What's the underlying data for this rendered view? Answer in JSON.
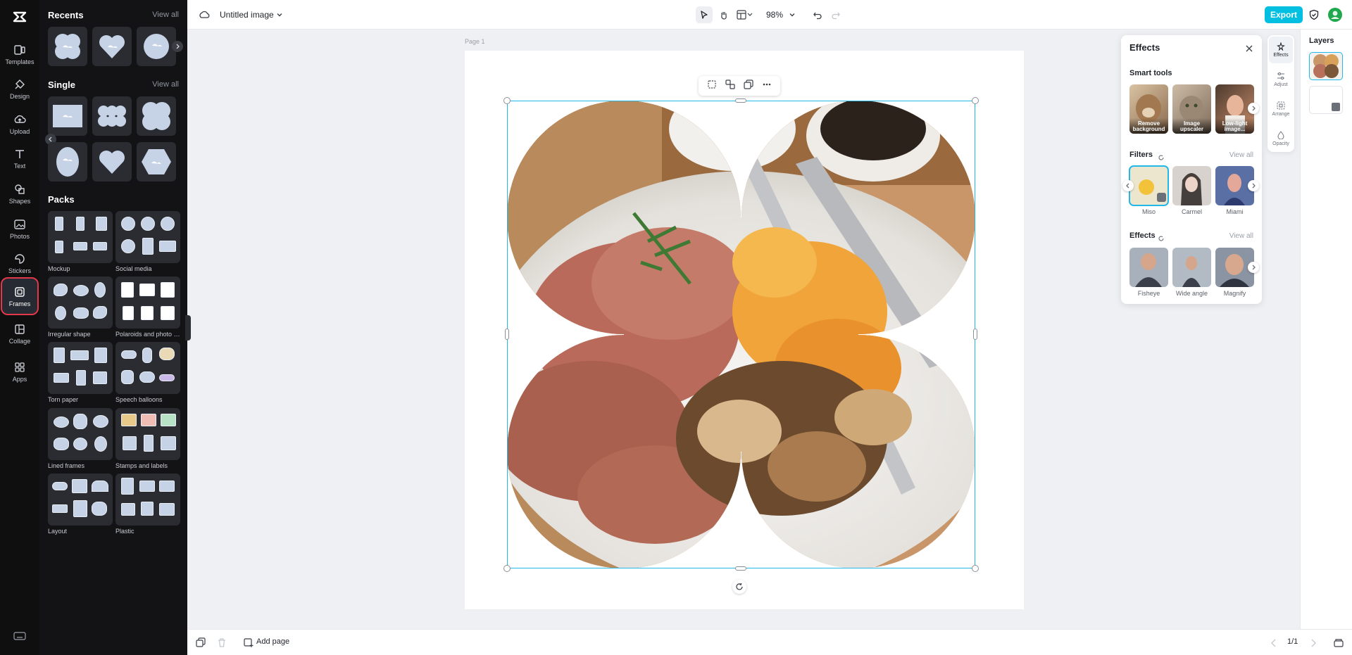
{
  "rail": {
    "items": [
      {
        "label": "Templates",
        "icon": "templates-icon"
      },
      {
        "label": "Design",
        "icon": "design-icon"
      },
      {
        "label": "Upload",
        "icon": "upload-icon"
      },
      {
        "label": "Text",
        "icon": "text-icon"
      },
      {
        "label": "Shapes",
        "icon": "shapes-icon"
      },
      {
        "label": "Photos",
        "icon": "photos-icon"
      },
      {
        "label": "Stickers",
        "icon": "stickers-icon"
      },
      {
        "label": "Frames",
        "icon": "frames-icon",
        "active": true
      },
      {
        "label": "Collage",
        "icon": "collage-icon"
      },
      {
        "label": "Apps",
        "icon": "apps-icon"
      }
    ]
  },
  "library": {
    "recents_title": "Recents",
    "recents_view_all": "View all",
    "single_title": "Single",
    "single_view_all": "View all",
    "packs_title": "Packs",
    "packs": [
      {
        "label": "Mockup"
      },
      {
        "label": "Social media"
      },
      {
        "label": "Irregular shape"
      },
      {
        "label": "Polaroids and photo f..."
      },
      {
        "label": "Torn paper"
      },
      {
        "label": "Speech balloons"
      },
      {
        "label": "Lined frames"
      },
      {
        "label": "Stamps and labels"
      },
      {
        "label": "Layout"
      },
      {
        "label": "Plastic"
      }
    ]
  },
  "topbar": {
    "doc_title": "Untitled image",
    "zoom": "98%",
    "export_label": "Export"
  },
  "canvas": {
    "page_label": "Page 1"
  },
  "effects": {
    "title": "Effects",
    "smart_tools_title": "Smart tools",
    "smart_tools": [
      "Remove background",
      "Image upscaler",
      "Low-light image..."
    ],
    "filters_title": "Filters",
    "filters_view_all": "View all",
    "filters": [
      "Miso",
      "Carmel",
      "Miami"
    ],
    "effects_title": "Effects",
    "effects_view_all": "View all",
    "effects_items": [
      "Fisheye",
      "Wide angle",
      "Magnify"
    ]
  },
  "tools": {
    "items": [
      "Effects",
      "Adjust",
      "Arrange",
      "Opacity"
    ]
  },
  "layers": {
    "title": "Layers"
  },
  "bottombar": {
    "add_page": "Add page",
    "page_count": "1/1"
  },
  "colors": {
    "accent": "#00bfe0",
    "selection": "#22b8e8",
    "rail_active_outline": "#e2384a"
  }
}
